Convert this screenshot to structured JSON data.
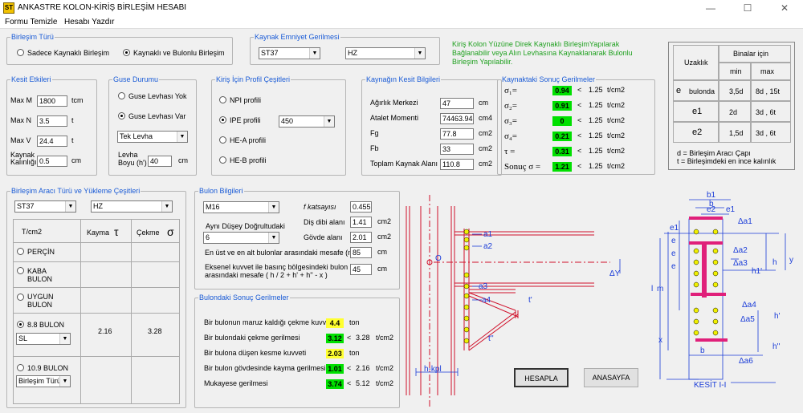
{
  "window": {
    "title": "ANKASTRE KOLON-KİRİŞ BİRLEŞİM HESABI",
    "app_icon": "ST",
    "minimize": "—",
    "maximize": "☐",
    "close": "✕"
  },
  "menu": [
    "Formu Temizle",
    "Hesabı Yazdır"
  ],
  "birlesim_turu": {
    "legend": "Birleşim Türü",
    "opt1": "Sadece Kaynaklı Birleşim",
    "opt2": "Kaynaklı ve Bulonlu Birleşim",
    "selected": 2
  },
  "kaynak_emniyet": {
    "legend": "Kaynak Emniyet Gerilmesi",
    "steel": "ST37",
    "load": "HZ"
  },
  "info_text": "Kiriş Kolon Yüzüne Direk Kaynaklı BirleşimYapılarak Bağlanabilir veya Alın Levhasına Kaynaklanarak Bulonlu Birleşim Yapılabilir.",
  "kesit": {
    "legend": "Kesit Etkileri",
    "m_label": "Max M",
    "m_val": "1800",
    "m_unit": "tcm",
    "n_label": "Max N",
    "n_val": "3.5",
    "n_unit": "t",
    "v_label": "Max V",
    "v_val": "24.4",
    "v_unit": "t",
    "k_label1": "Kaynak",
    "k_label2": "Kalınlığı",
    "k_val": "0.5",
    "k_unit": "cm"
  },
  "guse": {
    "legend": "Guse Durumu",
    "opt1": "Guse Levhası Yok",
    "opt2": "Guse Levhası Var",
    "type": "Tek Levha",
    "boy_label1": "Levha",
    "boy_label2": "Boyu (h')",
    "boy_val": "40",
    "boy_unit": "cm"
  },
  "profil": {
    "legend": "Kiriş İçin Profil Çeşitleri",
    "npi": "NPI profili",
    "ipe": "IPE profili",
    "ipe_size": "450",
    "hea": "HE-A profili",
    "heb": "HE-B profili"
  },
  "kaynak_kesit": {
    "legend": "Kaynağın Kesit Bilgileri",
    "rows": [
      {
        "label": "Ağırlık Merkezi",
        "value": "47",
        "unit": "cm"
      },
      {
        "label": "Atalet Momenti",
        "value": "74463.94",
        "unit": "cm4"
      },
      {
        "label": "Fg",
        "value": "77.8",
        "unit": "cm2"
      },
      {
        "label": "Fb",
        "value": "33",
        "unit": "cm2"
      },
      {
        "label": "Toplam Kaynak Alanı",
        "value": "110.8",
        "unit": "cm2"
      }
    ]
  },
  "sonuc": {
    "legend": "Kaynaktaki Sonuç Gerilmeler",
    "rows": [
      {
        "sym": "σ₁=",
        "value": "0.94",
        "lt": "<",
        "lim": "1.25",
        "unit": "t/cm2"
      },
      {
        "sym": "σ₂=",
        "value": "0.91",
        "lt": "<",
        "lim": "1.25",
        "unit": "t/cm2"
      },
      {
        "sym": "σ₃=",
        "value": "0",
        "lt": "<",
        "lim": "1.25",
        "unit": "t/cm2"
      },
      {
        "sym": "σ₄=",
        "value": "0.21",
        "lt": "<",
        "lim": "1.25",
        "unit": "t/cm2"
      },
      {
        "sym": "τ =",
        "value": "0.31",
        "lt": "<",
        "lim": "1.25",
        "unit": "t/cm2"
      },
      {
        "sym": "Sonuç σ =",
        "value": "1.21",
        "lt": "<",
        "lim": "1.25",
        "unit": "t/cm2"
      }
    ]
  },
  "table": {
    "uzaklik": "Uzaklık",
    "binalar": "Binalar için",
    "min": "min",
    "max": "max",
    "rows": [
      {
        "sym": "e",
        "sub": "bulonda",
        "min": "3,5d",
        "max": "8d , 15t"
      },
      {
        "sym": "e1",
        "sub": "",
        "min": "2d",
        "max": "3d , 6t"
      },
      {
        "sym": "e2",
        "sub": "",
        "min": "1,5d",
        "max": "3d , 6t"
      }
    ],
    "note1": "d = Birleşim Aracı Çapı",
    "note2": "t = Birleşimdeki en ince kalınlık"
  },
  "arac": {
    "legend": "Birleşim Aracı Türü ve Yükleme Çeşitleri",
    "steel": "ST37",
    "load": "HZ",
    "hdr_unit": "T/cm2",
    "hdr_kayma": "Kayma",
    "hdr_tau": "τ",
    "hdr_cekme": "Çekme",
    "hdr_sigma": "σ",
    "perçin": "PERÇİN",
    "kaba1": "KABA",
    "kaba2": "BULON",
    "uygun1": "UYGUN",
    "uygun2": "BULON",
    "b88": "8.8 BULON",
    "b88_type": "SL",
    "b88_kayma": "2.16",
    "b88_cekme": "3.28",
    "b109": "10.9 BULON",
    "b109_type": "Birleşim Türü"
  },
  "bulon": {
    "legend": "Bulon Bilgileri",
    "size": "M16",
    "f_label": "f katsayısı",
    "f_val": "0.455",
    "dis_label": "Diş dibi alanı",
    "dis_val": "1.41",
    "dis_unit": "cm2",
    "ayni_label": "Aynı Düşey Doğrultudaki",
    "ayni_val": "6",
    "govde_label": "Gövde alanı",
    "govde_val": "2.01",
    "govde_unit": "cm2",
    "mesafe_label": "En üst ve en alt bulonlar arasındaki mesafe (m)",
    "mesafe_val": "85",
    "mesafe_unit": "cm",
    "eks_label1": "Eksenel kuvvet ile basınç bölgesindeki bulon",
    "eks_label2": "arasındaki mesafe ( h / 2 + h' + h'' - x )",
    "eks_val": "45",
    "eks_unit": "cm"
  },
  "bulon_sonuc": {
    "legend": "Bulondaki Sonuç Gerilmeler",
    "rows": [
      {
        "label": "Bir bulonun maruz kaldığı çekme kuvveti",
        "value": "4.4",
        "color": "yellow",
        "lt": "",
        "lim": "",
        "unit": "ton"
      },
      {
        "label": "Bir bulondaki çekme gerilmesi",
        "value": "3.12",
        "color": "green",
        "lt": "<",
        "lim": "3.28",
        "unit": "t/cm2"
      },
      {
        "label": "Bir bulona düşen kesme kuvveti",
        "value": "2.03",
        "color": "yellow",
        "lt": "",
        "lim": "",
        "unit": "ton"
      },
      {
        "label": "Bir bulon gövdesinde kayma gerilmesi",
        "value": "1.01",
        "color": "green",
        "lt": "<",
        "lim": "2.16",
        "unit": "t/cm2"
      },
      {
        "label": "Mukayese gerilmesi",
        "value": "3.74",
        "color": "green",
        "lt": "<",
        "lim": "5.12",
        "unit": "t/cm2"
      }
    ]
  },
  "buttons": {
    "hesapla": "HESAPLA",
    "anasayfa": "ANASAYFA"
  },
  "drawing": {
    "a1": "a1",
    "a2": "a2",
    "a3": "a3",
    "a4": "a4",
    "o": "O",
    "dy": "ΔY",
    "t1": "t'",
    "t2": "t''",
    "hkp": "h-kpl",
    "b1": "b1",
    "b": "b",
    "e2": "e2",
    "e1": "e1",
    "e": "e",
    "da1": "Δa1",
    "da2": "Δa2",
    "da3": "Δa3",
    "da4": "Δa4",
    "da5": "Δa5",
    "da6": "Δa6",
    "h": "h",
    "y": "y",
    "h1": "h1'",
    "l": "l",
    "m": "m",
    "hp": "h'",
    "hpp": "h''",
    "x": "x",
    "kesit": "KESİT I-I"
  }
}
